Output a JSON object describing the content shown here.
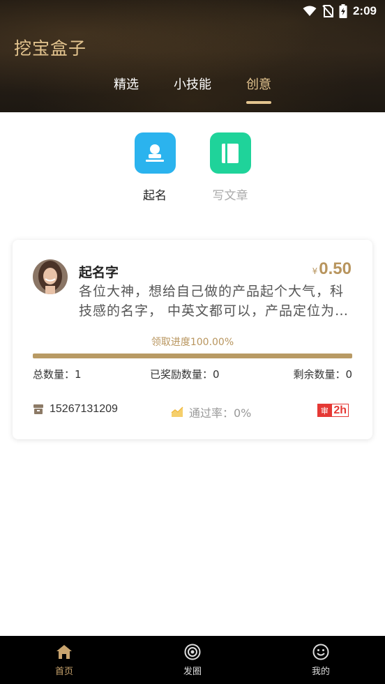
{
  "status_bar": {
    "time": "2:09"
  },
  "app": {
    "title": "挖宝盒子"
  },
  "tabs": [
    {
      "label": "精选"
    },
    {
      "label": "小技能"
    },
    {
      "label": "创意"
    }
  ],
  "categories": [
    {
      "label": "起名",
      "icon": "stamp-icon",
      "color": "#2bb3ee"
    },
    {
      "label": "写文章",
      "icon": "notebook-icon",
      "color": "#1fd39a"
    }
  ],
  "task_card": {
    "title": "起名字",
    "price_symbol": "¥",
    "price": "0.50",
    "description": "各位大神，想给自己做的产品起个大气，科技感的名字， 中英文都可以，产品定位为…",
    "progress_text": "领取进度100.00%",
    "progress": 1.0,
    "total_label": "总数量：1",
    "rewarded_label": "已奖励数量：0",
    "remaining_label": "剩余数量：0",
    "phone": "15267131209",
    "pass_rate": "通过率：0%",
    "review_badge": "审",
    "review_time": "2h"
  },
  "bottom_nav": [
    {
      "label": "首页",
      "icon": "home-icon"
    },
    {
      "label": "发圈",
      "icon": "camera-icon"
    },
    {
      "label": "我的",
      "icon": "smiley-icon"
    }
  ],
  "colors": {
    "accent": "#e3c48f",
    "gold": "#b8955e",
    "red": "#e53935"
  }
}
